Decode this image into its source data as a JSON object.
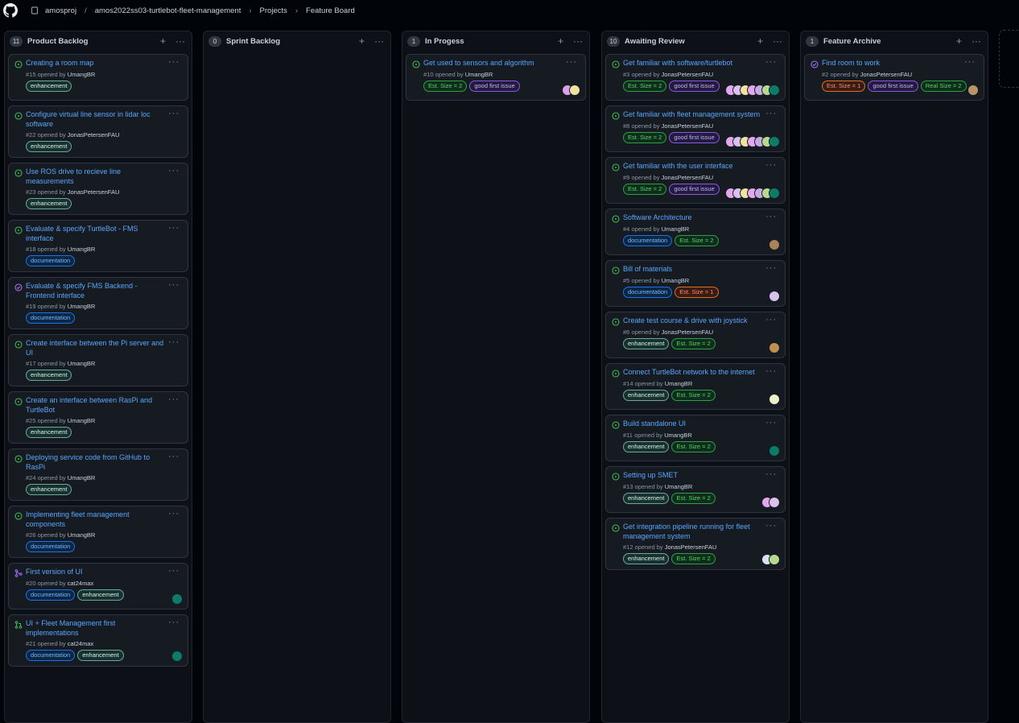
{
  "breadcrumb": {
    "org": "amosproj",
    "sep": "/",
    "repo": "amos2022ss03-turtlebot-fleet-management",
    "projects": "Projects",
    "board": "Feature Board"
  },
  "colors": {
    "enhancement": "#6fa59a",
    "documentation": "#1f6feb",
    "est": "#2ea043",
    "good_first_issue": "#8957e5",
    "open": "#3fb950",
    "closed": "#a371f7"
  },
  "columns": [
    {
      "title": "Product Backlog",
      "count": "11",
      "cards": [
        {
          "title": "Creating a room map",
          "num": "#15",
          "opened": "opened by",
          "author": "UmangBR",
          "icon": "issue-open-icon",
          "labels": [
            "enhancement"
          ],
          "avatars": []
        },
        {
          "title": "Configure virtual line sensor in lidar loc software",
          "num": "#22",
          "opened": "opened by",
          "author": "JonasPetersenFAU",
          "icon": "issue-open-icon",
          "labels": [
            "enhancement"
          ],
          "avatars": []
        },
        {
          "title": "Use ROS drive to recieve line measurements",
          "num": "#23",
          "opened": "opened by",
          "author": "JonasPetersenFAU",
          "icon": "issue-open-icon",
          "labels": [
            "enhancement"
          ],
          "avatars": []
        },
        {
          "title": "Evaluate & specify TurtleBot - FMS interface",
          "num": "#18",
          "opened": "opened by",
          "author": "UmangBR",
          "icon": "issue-open-icon",
          "labels": [
            "documentation"
          ],
          "avatars": []
        },
        {
          "title": "Evaluate & specify FMS Backend - Frontend interface",
          "num": "#19",
          "opened": "opened by",
          "author": "UmangBR",
          "icon": "issue-closed-icon",
          "labels": [
            "documentation"
          ],
          "avatars": []
        },
        {
          "title": "Create interface between the Pi server and UI",
          "num": "#17",
          "opened": "opened by",
          "author": "UmangBR",
          "icon": "issue-open-icon",
          "labels": [
            "enhancement"
          ],
          "avatars": []
        },
        {
          "title": "Create an interface between RasPi and TurtleBot",
          "num": "#25",
          "opened": "opened by",
          "author": "UmangBR",
          "icon": "issue-open-icon",
          "labels": [
            "enhancement"
          ],
          "avatars": []
        },
        {
          "title": "Deploying service code from GitHub to RasPi",
          "num": "#24",
          "opened": "opened by",
          "author": "UmangBR",
          "icon": "issue-open-icon",
          "labels": [
            "enhancement"
          ],
          "avatars": []
        },
        {
          "title": "Implementing fleet management components",
          "num": "#26",
          "opened": "opened by",
          "author": "UmangBR",
          "icon": "issue-open-icon",
          "labels": [
            "documentation"
          ],
          "avatars": []
        },
        {
          "title": "First version of UI",
          "num": "#20",
          "opened": "opened by",
          "author": "cat24max",
          "icon": "pr-merged-icon",
          "labels": [
            "documentation",
            "enhancement"
          ],
          "avatars": [
            "#0e7a6a"
          ]
        },
        {
          "title": "UI + Fleet Management first implementations",
          "num": "#21",
          "opened": "opened by",
          "author": "cat24max",
          "icon": "pr-open-icon",
          "labels": [
            "documentation",
            "enhancement"
          ],
          "avatars": [
            "#0e7a6a"
          ]
        }
      ]
    },
    {
      "title": "Sprint Backlog",
      "count": "0",
      "cards": []
    },
    {
      "title": "In Progess",
      "count": "1",
      "cards": [
        {
          "title": "Get used to sensors and algorithm",
          "num": "#10",
          "opened": "opened by",
          "author": "UmangBR",
          "icon": "issue-open-icon",
          "labels": [
            "Est. Size = 2",
            "good first issue"
          ],
          "avatars": [
            "#d9a3e8",
            "#efe3a0"
          ]
        }
      ]
    },
    {
      "title": "Awaiting Review",
      "count": "10",
      "cards": [
        {
          "title": "Get familiar with software/turtlebot",
          "num": "#3",
          "opened": "opened by",
          "author": "JonasPetersenFAU",
          "icon": "issue-open-icon",
          "labels": [
            "Est. Size = 2",
            "good first issue"
          ],
          "avatars": [
            "#e2a7ef",
            "#d9c1ec",
            "#efe3a0",
            "#e2a7ef",
            "#c9a8e3",
            "#b6d98f",
            "#0e7a6a"
          ]
        },
        {
          "title": "Get familiar with fleet management system",
          "num": "#8",
          "opened": "opened by",
          "author": "JonasPetersenFAU",
          "icon": "issue-open-icon",
          "labels": [
            "Est. Size = 2",
            "good first issue"
          ],
          "avatars": [
            "#e2a7ef",
            "#d9c1ec",
            "#efe3a0",
            "#e2a7ef",
            "#c9a8e3",
            "#b6d98f",
            "#0e7a6a"
          ]
        },
        {
          "title": "Get familiar with the user interface",
          "num": "#9",
          "opened": "opened by",
          "author": "JonasPetersenFAU",
          "icon": "issue-open-icon",
          "labels": [
            "Est. Size = 2",
            "good first issue"
          ],
          "avatars": [
            "#e2a7ef",
            "#d9c1ec",
            "#efe3a0",
            "#e2a7ef",
            "#c9a8e3",
            "#b6d98f",
            "#0e7a6a"
          ]
        },
        {
          "title": "Software Architecture",
          "num": "#4",
          "opened": "opened by",
          "author": "UmangBR",
          "icon": "issue-open-icon",
          "labels": [
            "documentation",
            "Est. Size = 2"
          ],
          "avatars": [
            "#a8835a"
          ]
        },
        {
          "title": "Bill of materials",
          "num": "#5",
          "opened": "opened by",
          "author": "UmangBR",
          "icon": "issue-open-icon",
          "labels": [
            "documentation",
            "Est. Size = 1"
          ],
          "avatars": [
            "#d9c1ec"
          ]
        },
        {
          "title": "Create test course & drive with joystick",
          "num": "#6",
          "opened": "opened by",
          "author": "JonasPetersenFAU",
          "icon": "issue-open-icon",
          "labels": [
            "enhancement",
            "Est. Size = 2"
          ],
          "avatars": [
            "#c09050"
          ]
        },
        {
          "title": "Connect TurtleBot network to the internet",
          "num": "#14",
          "opened": "opened by",
          "author": "UmangBR",
          "icon": "issue-open-icon",
          "labels": [
            "enhancement",
            "Est. Size = 2"
          ],
          "avatars": [
            "#ecefc8"
          ]
        },
        {
          "title": "Build standalone UI",
          "num": "#11",
          "opened": "opened by",
          "author": "UmangBR",
          "icon": "issue-open-icon",
          "labels": [
            "enhancement",
            "Est. Size = 2"
          ],
          "avatars": [
            "#0e7a6a"
          ]
        },
        {
          "title": "Setting up SMET",
          "num": "#13",
          "opened": "opened by",
          "author": "UmangBR",
          "icon": "issue-open-icon",
          "labels": [
            "enhancement",
            "Est. Size = 2"
          ],
          "avatars": [
            "#e2a7ef",
            "#d9c1ec"
          ]
        },
        {
          "title": "Get integration pipeline running for fleet management system",
          "num": "#12",
          "opened": "opened by",
          "author": "JonasPetersenFAU",
          "icon": "issue-open-icon",
          "labels": [
            "enhancement",
            "Est. Size = 2"
          ],
          "avatars": [
            "#d6e2f2",
            "#b6d98f"
          ]
        }
      ]
    },
    {
      "title": "Feature Archive",
      "count": "1",
      "cards": [
        {
          "title": "Find room to work",
          "num": "#2",
          "opened": "opened by",
          "author": "JonasPetersenFAU",
          "icon": "issue-closed-icon",
          "labels": [
            "Est. Size = 1",
            "good first issue",
            "Real Size = 2"
          ],
          "avatars": [
            "#b8946a"
          ]
        }
      ]
    }
  ]
}
